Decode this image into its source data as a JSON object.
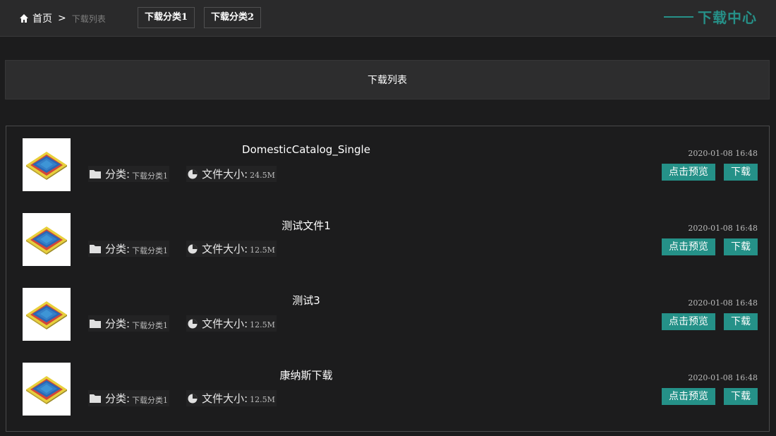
{
  "breadcrumb": {
    "home": "首页",
    "separator": ">",
    "current": "下载列表"
  },
  "categories": [
    "下载分类1",
    "下载分类2"
  ],
  "brand": "下载中心",
  "section_title": "下载列表",
  "labels": {
    "category": "分类:",
    "size": "文件大小:"
  },
  "buttons": {
    "preview": "点击预览",
    "download": "下载"
  },
  "accent_color": "#269088",
  "files": [
    {
      "name": "DomesticCatalog_Single",
      "category": "下载分类1",
      "size": "24.5M",
      "date": "2020-01-08 16:48"
    },
    {
      "name": "测试文件1",
      "category": "下载分类1",
      "size": "12.5M",
      "date": "2020-01-08 16:48"
    },
    {
      "name": "测试3",
      "category": "下载分类1",
      "size": "12.5M",
      "date": "2020-01-08 16:48"
    },
    {
      "name": "康纳斯下载",
      "category": "下载分类1",
      "size": "12.5M",
      "date": "2020-01-08 16:48"
    }
  ]
}
